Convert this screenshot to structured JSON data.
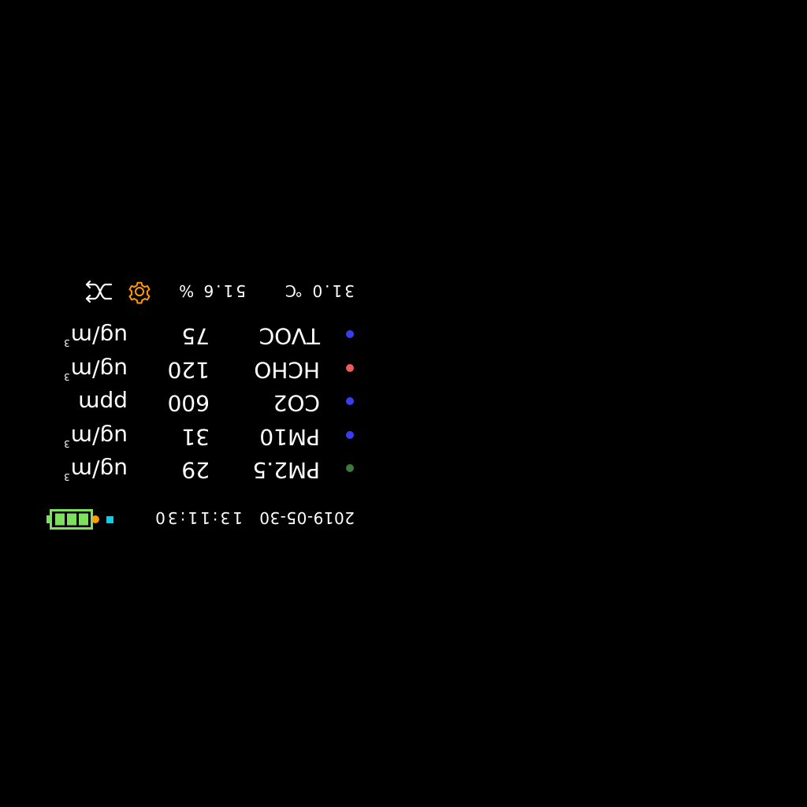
{
  "status_bar": {
    "date": "2019-05-30",
    "time": "13:11:30",
    "battery_level": 1.0,
    "indicator_square_color": "#00d2f0",
    "indicator_dot_color": "#ff9a00",
    "battery_color": "#7ee05f"
  },
  "readings": [
    {
      "name": "PM2.5",
      "value": "29",
      "unit": "ug/m",
      "unit_sup": "3",
      "dot_color": "#3c7a3c"
    },
    {
      "name": "PM10",
      "value": "31",
      "unit": "ug/m",
      "unit_sup": "3",
      "dot_color": "#3a3cf0"
    },
    {
      "name": "CO2",
      "value": "600",
      "unit": "ppm",
      "unit_sup": "",
      "dot_color": "#3a3cf0"
    },
    {
      "name": "HCHO",
      "value": "120",
      "unit": "ug/m",
      "unit_sup": "3",
      "dot_color": "#f05a5a"
    },
    {
      "name": "TVOC",
      "value": "75",
      "unit": "ug/m",
      "unit_sup": "3",
      "dot_color": "#3a3cf0"
    }
  ],
  "environment": {
    "temperature": "31.0 ℃",
    "humidity": "51.6 %"
  },
  "controls": {
    "settings_icon": "gear-icon",
    "shuffle_icon": "shuffle-icon",
    "settings_color": "#ff9a00",
    "shuffle_color": "#ffffff"
  }
}
